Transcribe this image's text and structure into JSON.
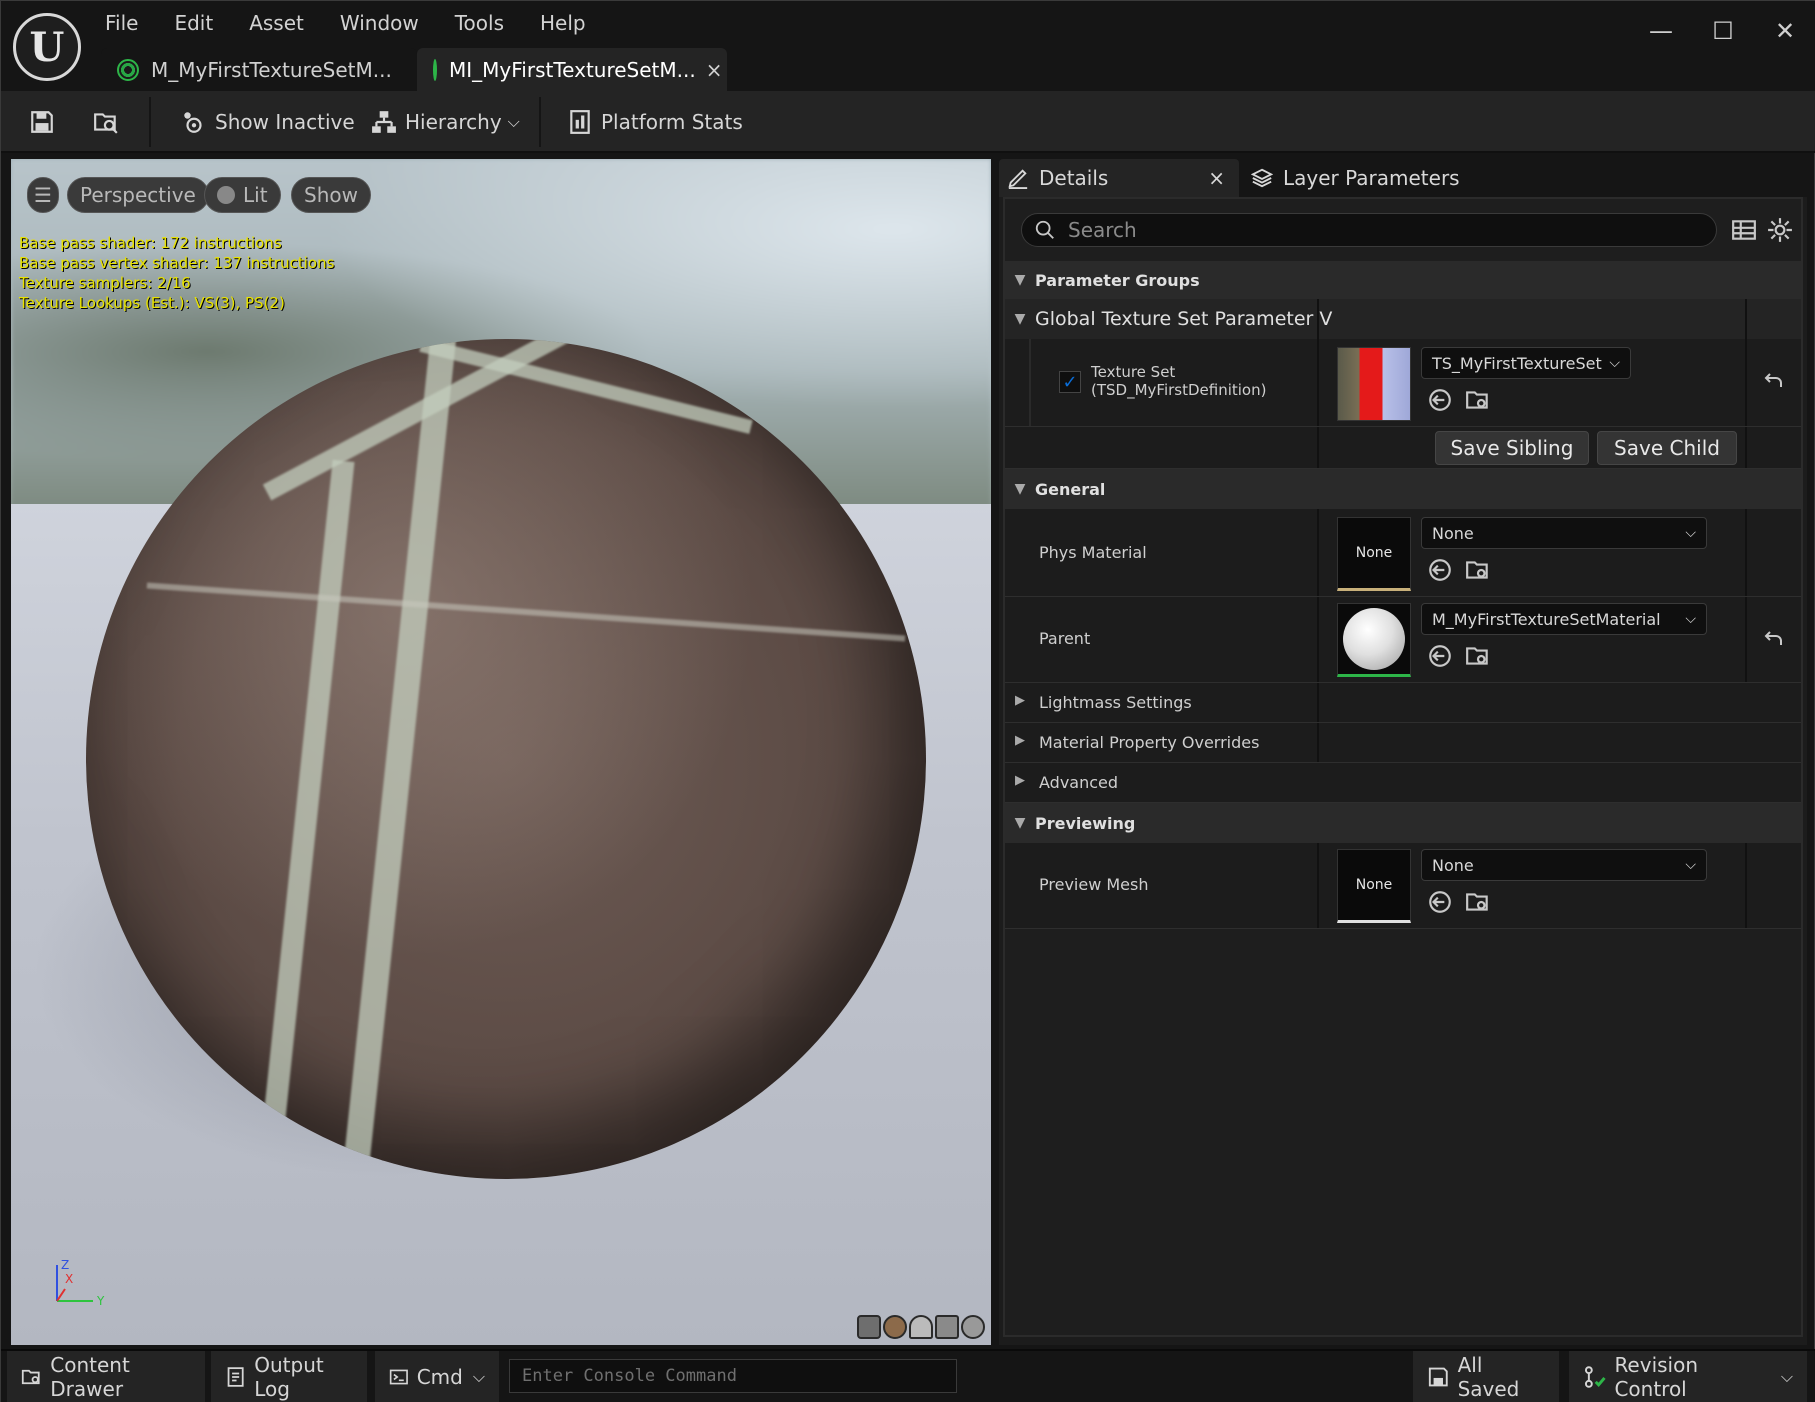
{
  "app": {
    "menu": [
      "File",
      "Edit",
      "Asset",
      "Window",
      "Tools",
      "Help"
    ],
    "window_controls": {
      "minimize": "—",
      "maximize": "☐",
      "close": "✕"
    }
  },
  "tabs": [
    {
      "label": "M_MyFirstTextureSetM...",
      "active": false
    },
    {
      "label": "MI_MyFirstTextureSetM...",
      "active": true,
      "close": "×"
    }
  ],
  "toolbar": {
    "show_inactive": "Show Inactive",
    "hierarchy": "Hierarchy",
    "platform_stats": "Platform Stats"
  },
  "viewport": {
    "perspective": "Perspective",
    "lit": "Lit",
    "show": "Show",
    "stats": [
      "Base pass shader: 172 instructions",
      "Base pass vertex shader: 137 instructions",
      "Texture samplers: 2/16",
      "Texture Lookups (Est.): VS(3), PS(2)"
    ],
    "axis": {
      "z": "Z",
      "x": "X",
      "y": "Y"
    }
  },
  "details": {
    "tab_details": "Details",
    "tab_details_close": "×",
    "tab_layer_params": "Layer Parameters",
    "search_placeholder": "Search",
    "sections": {
      "parameter_groups": "Parameter Groups",
      "global_texture_set": "Global Texture Set Parameter V",
      "general": "General",
      "lightmass": "Lightmass Settings",
      "material_overrides": "Material Property Overrides",
      "advanced": "Advanced",
      "previewing": "Previewing"
    },
    "texture_set": {
      "label_line1": "Texture Set",
      "label_line2": "(TSD_MyFirstDefinition)",
      "checked": true,
      "value": "TS_MyFirstTextureSet",
      "save_sibling": "Save Sibling",
      "save_child": "Save Child"
    },
    "phys_material": {
      "label": "Phys Material",
      "thumb": "None",
      "value": "None"
    },
    "parent": {
      "label": "Parent",
      "value": "M_MyFirstTextureSetMaterial"
    },
    "preview_mesh": {
      "label": "Preview Mesh",
      "thumb": "None",
      "value": "None"
    }
  },
  "statusbar": {
    "content_drawer": "Content Drawer",
    "output_log": "Output Log",
    "cmd": "Cmd",
    "console_placeholder": "Enter Console Command",
    "all_saved": "All Saved",
    "revision_control": "Revision Control"
  },
  "colors": {
    "accent_blue": "#0a6cd6",
    "tab_green": "#2db548",
    "stats_yellow": "#e8e200",
    "texture_red": "#e41a1a"
  }
}
